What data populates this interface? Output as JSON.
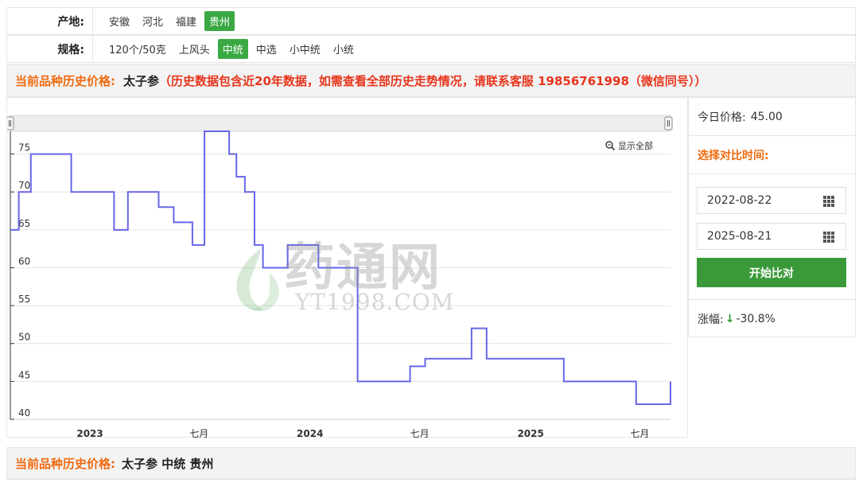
{
  "filters": {
    "origin": {
      "label": "产地:",
      "options": [
        "安徽",
        "河北",
        "福建",
        "贵州"
      ],
      "active": "贵州"
    },
    "spec": {
      "label": "规格:",
      "options": [
        "120个/50克",
        "上风头",
        "中统",
        "中选",
        "小中统",
        "小统"
      ],
      "active": "中统"
    }
  },
  "banner": {
    "prefix": "当前品种历史价格:",
    "herb": "太子参",
    "note": "（历史数据包含近20年数据，如需查看全部历史走势情况，请联系客服 19856761998（微信同号））"
  },
  "side": {
    "today_price_label": "今日价格:",
    "today_price": "45.00",
    "compare_title": "选择对比时间:",
    "date_start": "2022-08-22",
    "date_end": "2025-08-21",
    "compare_button": "开始比对",
    "change_label": "涨幅:",
    "change_arrow": "↓",
    "change_value": "-30.8%"
  },
  "chart": {
    "zoom_reset": "显示全部",
    "watermark_main": "药通网",
    "watermark_sub": "YT1998.COM",
    "x_labels": [
      "2023",
      "七月",
      "2024",
      "七月",
      "2025",
      "七月"
    ],
    "y_labels": [
      "40",
      "45",
      "50",
      "55",
      "60",
      "65",
      "70",
      "75"
    ],
    "line_color": "#6666e8"
  },
  "chart_data": {
    "type": "line",
    "step": true,
    "ylim": [
      40,
      78
    ],
    "points": [
      [
        "2022-08-22",
        65
      ],
      [
        "2022-09-05",
        70
      ],
      [
        "2022-09-25",
        75
      ],
      [
        "2022-12-01",
        70
      ],
      [
        "2023-02-10",
        65
      ],
      [
        "2023-03-05",
        70
      ],
      [
        "2023-04-25",
        68
      ],
      [
        "2023-05-20",
        66
      ],
      [
        "2023-06-20",
        63
      ],
      [
        "2023-07-10",
        78
      ],
      [
        "2023-08-20",
        75
      ],
      [
        "2023-09-01",
        72
      ],
      [
        "2023-09-15",
        70
      ],
      [
        "2023-10-01",
        63
      ],
      [
        "2023-10-15",
        60
      ],
      [
        "2023-11-25",
        63
      ],
      [
        "2024-01-15",
        60
      ],
      [
        "2024-03-20",
        45
      ],
      [
        "2024-06-15",
        47
      ],
      [
        "2024-07-10",
        48
      ],
      [
        "2024-09-25",
        52
      ],
      [
        "2024-10-20",
        48
      ],
      [
        "2025-02-25",
        45
      ],
      [
        "2025-06-25",
        42
      ],
      [
        "2025-08-21",
        45
      ]
    ]
  },
  "bottom": {
    "prefix": "当前品种历史价格:",
    "title": "太子参 中统 贵州"
  }
}
